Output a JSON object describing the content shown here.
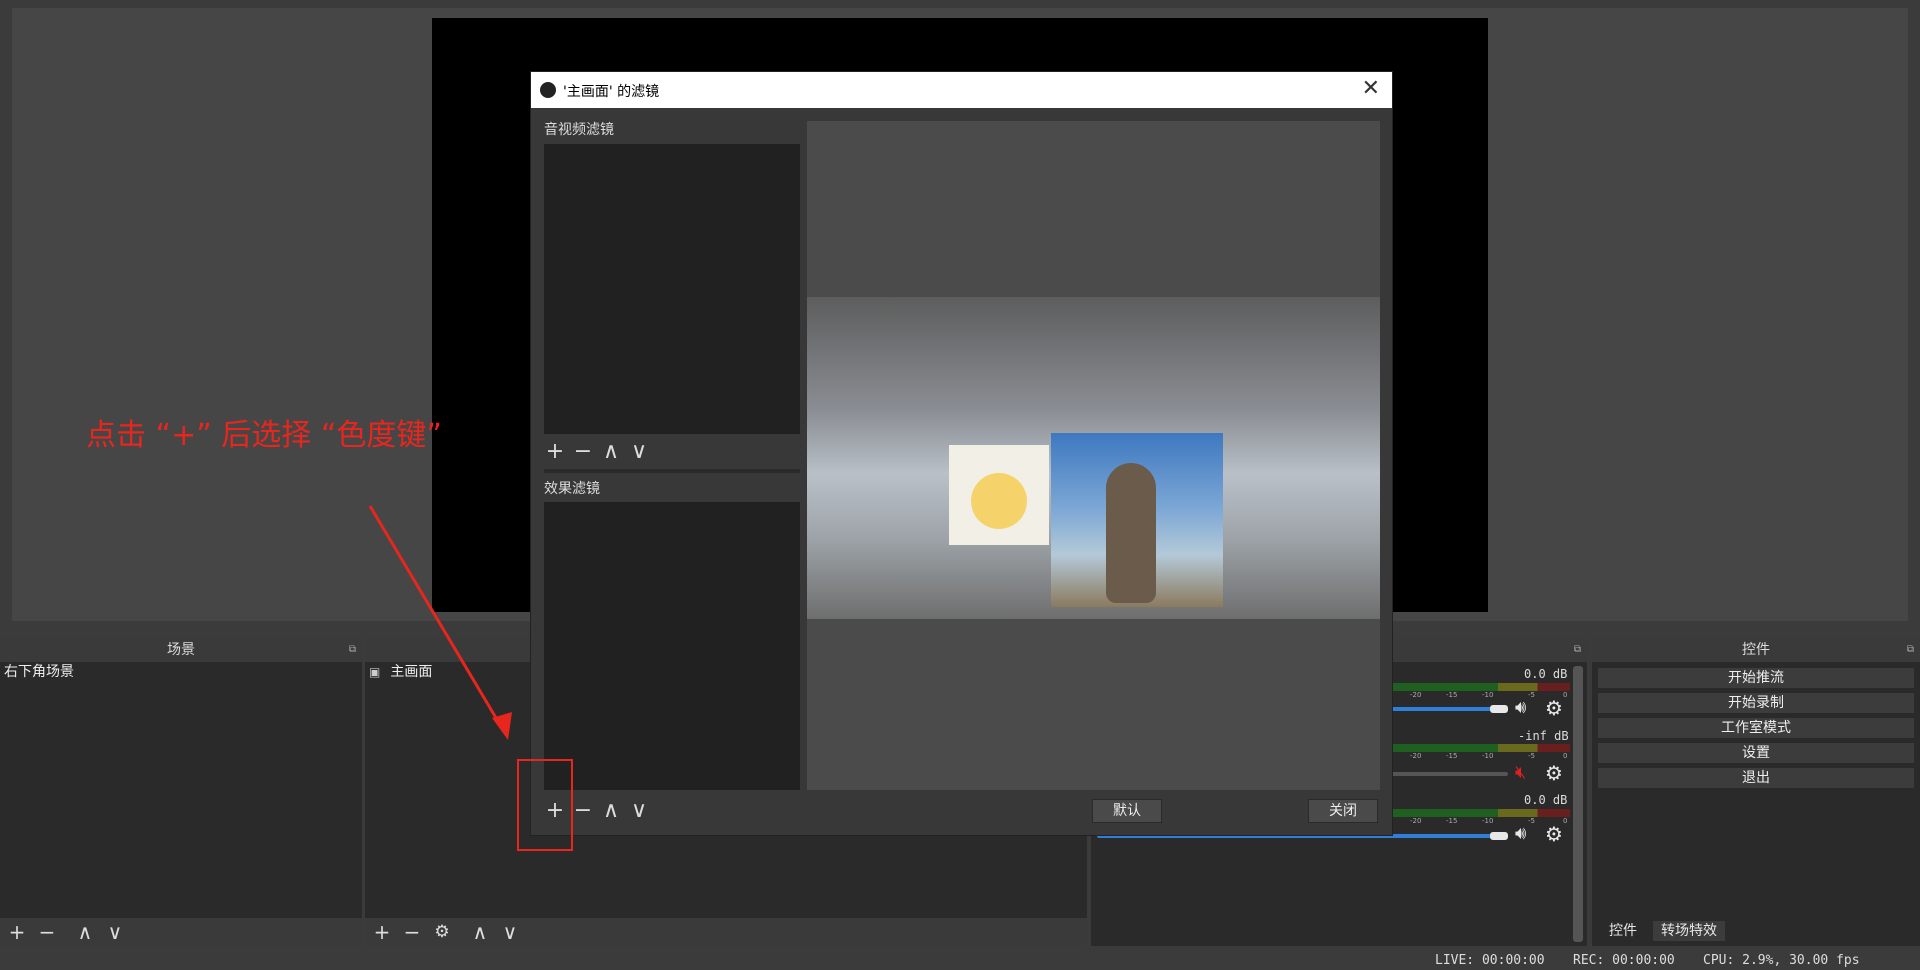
{
  "docks": {
    "scenes": {
      "title": "场景",
      "items": [
        "右下角场景"
      ]
    },
    "sources": {
      "items": [
        "主画面"
      ]
    },
    "controls": {
      "title": "控件",
      "buttons": [
        "开始推流",
        "开始录制",
        "工作室模式",
        "设置",
        "退出"
      ],
      "tabs": [
        "控件",
        "转场特效"
      ]
    },
    "audio": {
      "channels": [
        {
          "db": "0.0 dB",
          "volume": 1.0,
          "muted": false
        },
        {
          "db": "-inf dB",
          "volume": 1.0,
          "muted": true
        },
        {
          "db": "0.0 dB",
          "volume": 1.0,
          "muted": false
        }
      ],
      "scale": [
        "-20",
        "-15",
        "-10",
        "-5",
        "0"
      ]
    }
  },
  "dialog": {
    "title": "'主画面' 的滤镜",
    "av_filters_label": "音视频滤镜",
    "effect_filters_label": "效果滤镜",
    "default_button": "默认",
    "close_button": "关闭"
  },
  "toolbar_glyphs": {
    "add": "+",
    "remove": "−",
    "up": "∧",
    "down": "∨",
    "gear": "⚙"
  },
  "status": {
    "live": "LIVE: 00:00:00",
    "rec": "REC: 00:00:00",
    "cpu": "CPU: 2.9%, 30.00 fps"
  },
  "annotation": {
    "text": "点击 “+” 后选择 “色度键”",
    "color": "#e8261e"
  }
}
